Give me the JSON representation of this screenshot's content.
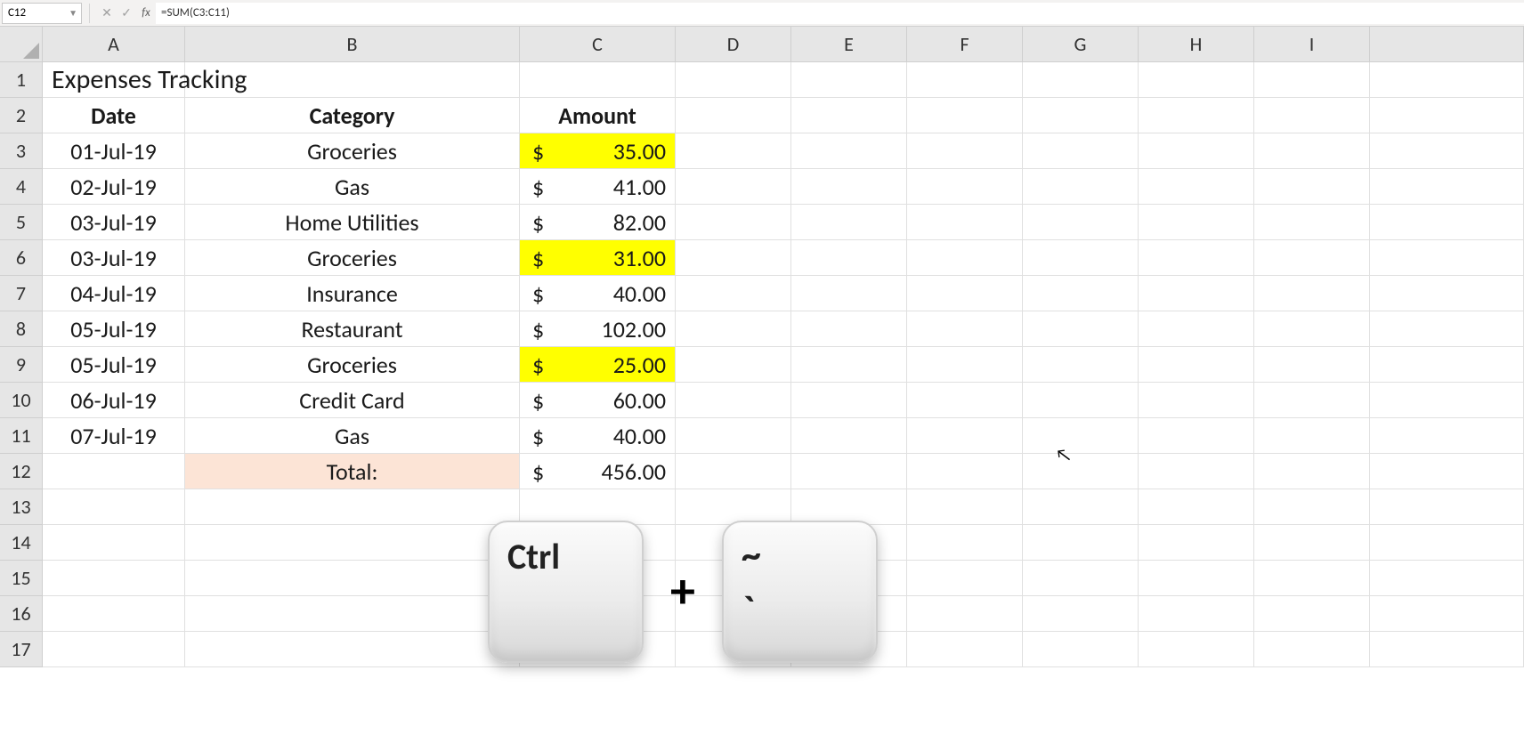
{
  "formula_bar": {
    "name_box": "C12",
    "formula": "=SUM(C3:C11)"
  },
  "columns": [
    "A",
    "B",
    "C",
    "D",
    "E",
    "F",
    "G",
    "H",
    "I"
  ],
  "rows": {
    "title": "Expenses Tracking",
    "headers": {
      "date": "Date",
      "category": "Category",
      "amount": "Amount"
    },
    "data": [
      {
        "date": "01-Jul-19",
        "category": "Groceries",
        "amount": "35.00",
        "highlight": true
      },
      {
        "date": "02-Jul-19",
        "category": "Gas",
        "amount": "41.00",
        "highlight": false
      },
      {
        "date": "03-Jul-19",
        "category": "Home Utilities",
        "amount": "82.00",
        "highlight": false
      },
      {
        "date": "03-Jul-19",
        "category": "Groceries",
        "amount": "31.00",
        "highlight": true
      },
      {
        "date": "04-Jul-19",
        "category": "Insurance",
        "amount": "40.00",
        "highlight": false
      },
      {
        "date": "05-Jul-19",
        "category": "Restaurant",
        "amount": "102.00",
        "highlight": false
      },
      {
        "date": "05-Jul-19",
        "category": "Groceries",
        "amount": "25.00",
        "highlight": true
      },
      {
        "date": "06-Jul-19",
        "category": "Credit Card",
        "amount": "60.00",
        "highlight": false
      },
      {
        "date": "07-Jul-19",
        "category": "Gas",
        "amount": "40.00",
        "highlight": false
      }
    ],
    "total_label": "Total:",
    "total_amount": "456.00",
    "currency_symbol": "$"
  },
  "keys": {
    "ctrl": "Ctrl",
    "plus": "+",
    "tilde_top": "~",
    "tilde_bot": "`"
  },
  "row_numbers": [
    "1",
    "2",
    "3",
    "4",
    "5",
    "6",
    "7",
    "8",
    "9",
    "10",
    "11",
    "12",
    "13",
    "14",
    "15",
    "16",
    "17"
  ]
}
